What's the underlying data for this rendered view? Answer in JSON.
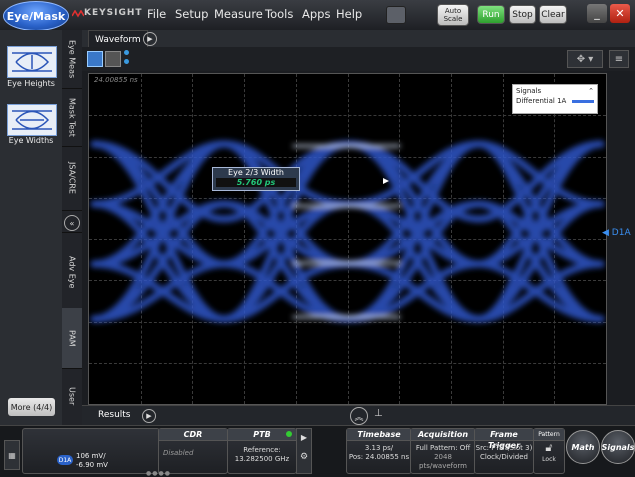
{
  "app": {
    "mode_button": "Eye/Mask",
    "brand": "KEYSIGHT",
    "menu": [
      "File",
      "Setup",
      "Measure",
      "Tools",
      "Apps",
      "Help"
    ],
    "toolbar": {
      "auto_scale": "Auto\nScale",
      "run": "Run",
      "stop": "Stop",
      "clear": "Clear"
    },
    "window_buttons": [
      "_",
      "✕"
    ]
  },
  "left_panel": {
    "items": [
      {
        "label": "Eye Heights",
        "icon": "eye-heights-icon"
      },
      {
        "label": "Eye Widths",
        "icon": "eye-widths-icon"
      }
    ],
    "more_button": "More (4/4)"
  },
  "vertical_tabs": [
    "Eye Meas",
    "Mask Test",
    "JSA/CRE",
    "«",
    "Adv Eye",
    "PAM",
    "User"
  ],
  "waveform": {
    "tab_label": "Waveform",
    "timestamp": "24.00855 ns",
    "legend_title": "Signals",
    "legend_item": "Differential 1A",
    "channel_marker": "D1A",
    "measurement_label": "Eye 2/3 Width",
    "measurement_value": "5.760 ps",
    "colors": {
      "trace": "#3f6fe0",
      "trace_bright": "#9fc0ff",
      "measure": "#22c77a"
    }
  },
  "results": {
    "label": "Results"
  },
  "status_bar": {
    "channel": {
      "badge": "D1A",
      "scale": "106 mV/",
      "offset": "-6.90 mV"
    },
    "cdr": {
      "header": "CDR",
      "value": "Disabled"
    },
    "ptb": {
      "header": "PTB",
      "line1": "Reference:",
      "line2": "13.282500 GHz"
    },
    "timebase": {
      "header": "Timebase",
      "line1": "3.13 ps/",
      "line2": "Pos: 24.00855 ns"
    },
    "acquisition": {
      "header": "Acquisition",
      "line1": "Full Pattern: Off",
      "line2": "2048 pts/waveform"
    },
    "frame_trigger": {
      "header": "Frame Trigger",
      "line1": "Src: PTB (Slot 3)",
      "line2": "Clock/Divided"
    },
    "pattern": {
      "header": "Pattern",
      "lock": "Lock"
    },
    "math": "Math",
    "signals": "Signals"
  }
}
